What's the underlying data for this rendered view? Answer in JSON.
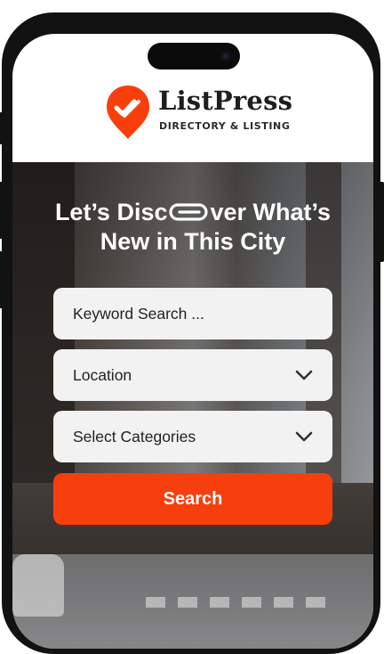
{
  "brand": {
    "name": "ListPress",
    "tagline": "DIRECTORY & LISTING",
    "accent": "#f73f0d"
  },
  "hero": {
    "headline_line1_part1": "Let’s Disc",
    "headline_icon": "paperclip-icon",
    "headline_line1_part2": "ver What’s",
    "headline_line2": "New in This City"
  },
  "search_form": {
    "keyword_placeholder": "Keyword Search ...",
    "location_label": "Location",
    "category_label": "Select Categories",
    "dropdown_icon": "chevron-down-icon",
    "submit_label": "Search"
  }
}
